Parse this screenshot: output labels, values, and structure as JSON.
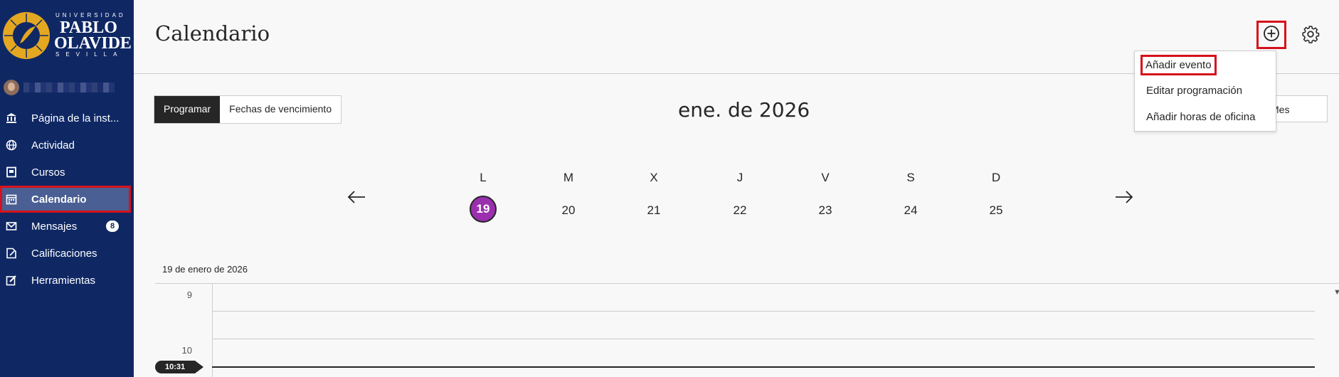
{
  "colors": {
    "sidebar_bg": "#0f2864",
    "sidebar_active_bg": "#4a5f93",
    "highlight_red": "#d6111b",
    "today_purple": "#9b2fae",
    "logo_gold": "#e3a721"
  },
  "logo": {
    "top_text": "UNIVERSIDAD",
    "main_line1": "PABLO",
    "main_line2": "OLAVIDE",
    "bottom_text": "SEVILLA"
  },
  "sidebar": {
    "items": [
      {
        "label": "Página de la inst...",
        "icon": "institution-icon"
      },
      {
        "label": "Actividad",
        "icon": "globe-icon"
      },
      {
        "label": "Cursos",
        "icon": "courses-icon"
      },
      {
        "label": "Calendario",
        "icon": "calendar-icon",
        "active": true
      },
      {
        "label": "Mensajes",
        "icon": "mail-icon",
        "badge": "8"
      },
      {
        "label": "Calificaciones",
        "icon": "grades-icon"
      },
      {
        "label": "Herramientas",
        "icon": "tools-icon"
      }
    ]
  },
  "header": {
    "title": "Calendario"
  },
  "add_menu": {
    "items": [
      "Añadir evento",
      "Editar programación",
      "Añadir horas de oficina"
    ]
  },
  "view_toggle": {
    "left": "Programar",
    "right": "Fechas de vencimiento"
  },
  "month_title": "ene. de 2026",
  "range_button": "Mes",
  "week": {
    "days": [
      {
        "letter": "L",
        "num": "19",
        "today": true
      },
      {
        "letter": "M",
        "num": "20"
      },
      {
        "letter": "X",
        "num": "21"
      },
      {
        "letter": "J",
        "num": "22"
      },
      {
        "letter": "V",
        "num": "23"
      },
      {
        "letter": "S",
        "num": "24"
      },
      {
        "letter": "D",
        "num": "25"
      }
    ]
  },
  "schedule": {
    "date_label": "19 de enero de 2026",
    "hours": [
      "9",
      "10"
    ],
    "now_time": "10:31"
  }
}
